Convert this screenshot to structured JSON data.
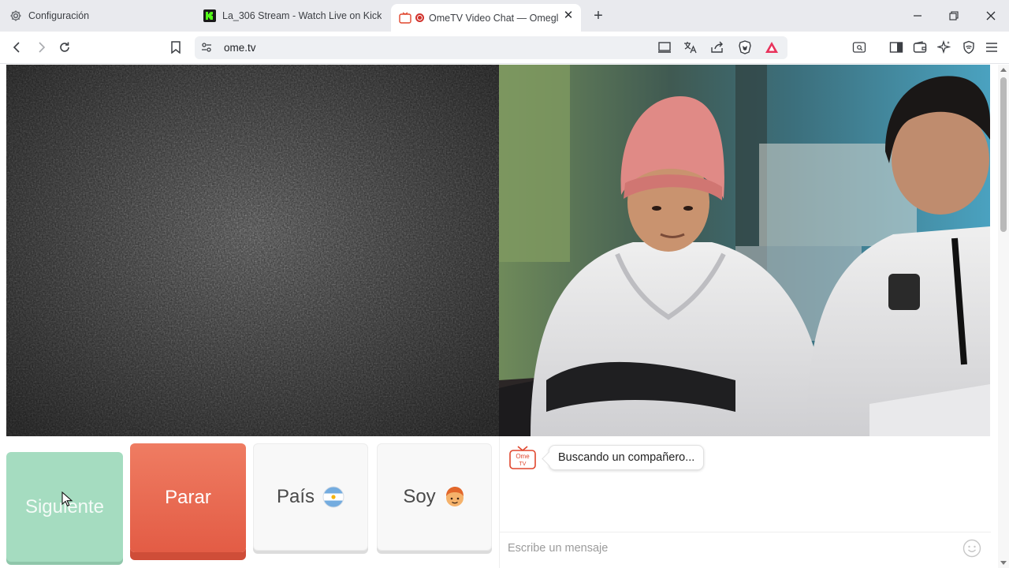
{
  "browser": {
    "tabs": [
      {
        "label": "Configuración",
        "icon": "gear-icon"
      },
      {
        "label": "La_306 Stream - Watch Live on Kick",
        "icon": "kick-logo-icon"
      },
      {
        "label": "OmeTV Video Chat — Omegl",
        "icon": "ometv-logo-icon",
        "active": true
      }
    ],
    "url": "ome.tv"
  },
  "controls": {
    "next_label": "Siguiente",
    "stop_label": "Parar",
    "country_label": "País",
    "country_flag": "argentina-flag-icon",
    "iam_label": "Soy",
    "iam_icon": "boy-emoji-icon"
  },
  "chat": {
    "status_message": "Buscando un compañero...",
    "input_placeholder": "Escribe un mensaje",
    "logo_text": "Ome TV"
  },
  "colors": {
    "next": "#a5dcc0",
    "stop": "#e35c45",
    "tile": "#f8f8f8"
  }
}
